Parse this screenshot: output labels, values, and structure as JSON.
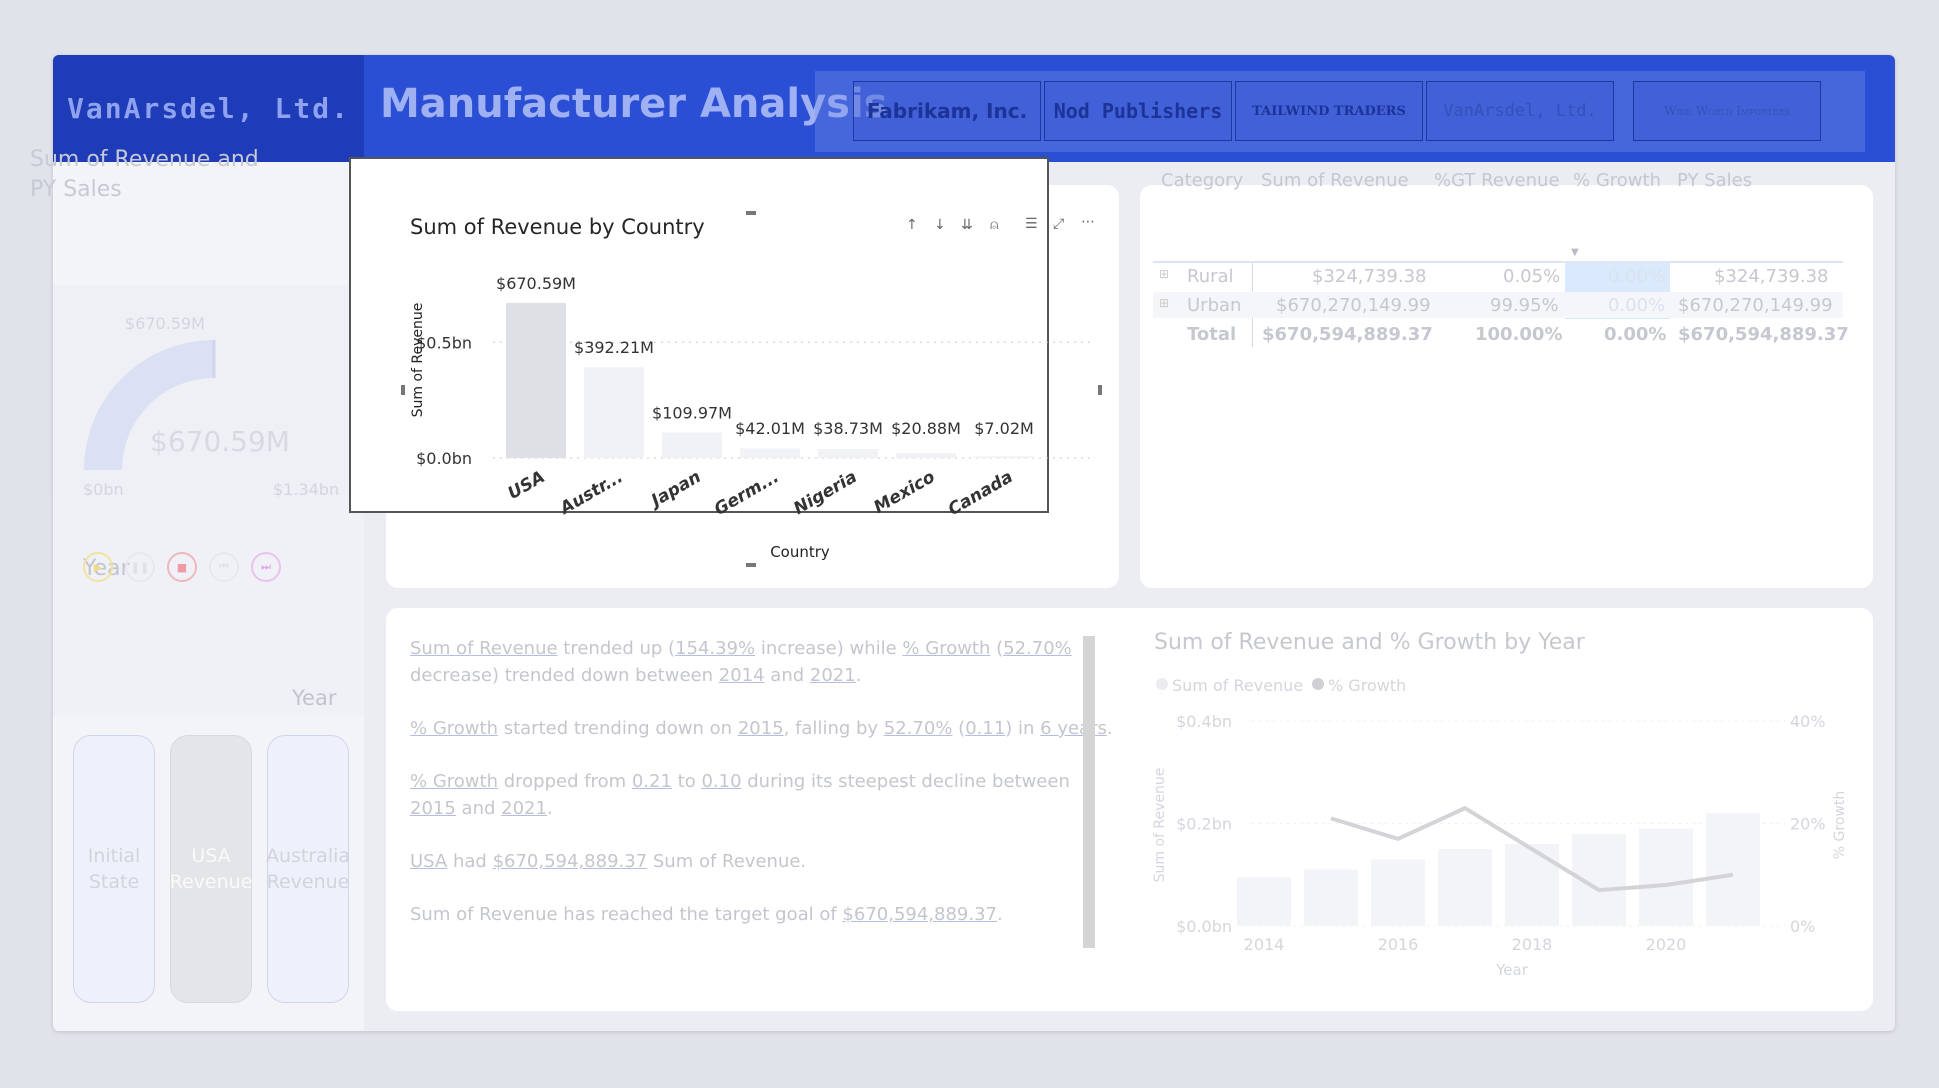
{
  "header": {
    "logo_text": "VanArsdel, Ltd.",
    "title": "Manufacturer Analysis",
    "manufacturers": [
      "Fabrikam, Inc.",
      "Nod Publishers",
      "TAILWIND TRADERS",
      "VanArsdel, Ltd.",
      "Wide World Importers"
    ]
  },
  "gauge": {
    "title": "Sum of Revenue and PY Sales",
    "target_label": "$670.59M",
    "value_label": "$670.59M",
    "min_label": "$0bn",
    "max_label": "$1.34bn",
    "fill_fraction": 0.5
  },
  "year_slicer": {
    "title": "Year",
    "play_label": "Year"
  },
  "bookmarks": [
    {
      "label": "Initial State"
    },
    {
      "label": "USA Revenue"
    },
    {
      "label": "Australia Revenue"
    }
  ],
  "bar_chart": {
    "toolbar_icons": [
      "sort-ascending-icon",
      "sort-descending-icon",
      "expand-all-icon",
      "drill-up-icon",
      "filter-icon",
      "focus-mode-icon",
      "more-options-icon"
    ]
  },
  "chart_data": [
    {
      "type": "bar",
      "title": "Sum of Revenue by Country",
      "xlabel": "Country",
      "ylabel": "Sum of Revenue",
      "categories": [
        "USA",
        "Austr...",
        "Japan",
        "Germ...",
        "Nigeria",
        "Mexico",
        "Canada"
      ],
      "values": [
        670.59,
        392.21,
        109.97,
        42.01,
        38.73,
        20.88,
        7.02
      ],
      "value_labels": [
        "$670.59M",
        "$392.21M",
        "$109.97M",
        "$42.01M",
        "$38.73M",
        "$20.88M",
        "$7.02M"
      ],
      "yticks": [
        "$0.0bn",
        "$0.5bn"
      ],
      "ytick_values": [
        0,
        500
      ],
      "ylim": [
        0,
        700
      ],
      "grid": true,
      "colors": {
        "highlight": "#dfe0e5",
        "dim": "#f1f2f6"
      }
    },
    {
      "type": "bar",
      "title": "Sum of Revenue and % Growth by Year",
      "xlabel": "Year",
      "ylabel": "Sum of Revenue",
      "y2label": "% Growth",
      "legend": [
        "Sum of Revenue",
        "% Growth"
      ],
      "legend_position": "top-left",
      "x": [
        2014,
        2015,
        2016,
        2017,
        2018,
        2019,
        2020,
        2021
      ],
      "xticks": [
        "2014",
        "2016",
        "2018",
        "2020"
      ],
      "series": [
        {
          "name": "Sum of Revenue",
          "values": [
            0.095,
            0.11,
            0.13,
            0.15,
            0.16,
            0.18,
            0.19,
            0.22
          ]
        },
        {
          "name": "% Growth",
          "values": [
            null,
            0.21,
            0.17,
            0.23,
            0.15,
            0.07,
            0.08,
            0.1
          ]
        }
      ],
      "yticks": [
        "$0.0bn",
        "$0.2bn",
        "$0.4bn"
      ],
      "y2ticks": [
        "0%",
        "20%",
        "40%"
      ],
      "ylim": [
        0,
        0.4
      ],
      "y2lim": [
        0,
        0.4
      ]
    }
  ],
  "table": {
    "columns": [
      "Category",
      "Sum of Revenue",
      "%GT Revenue",
      "% Growth",
      "PY Sales"
    ],
    "rows": [
      {
        "category": "Rural",
        "revenue": "$324,739.38",
        "gt": "0.05%",
        "growth": "0.00%",
        "py": "$324,739.38"
      },
      {
        "category": "Urban",
        "revenue": "$670,270,149.99",
        "gt": "99.95%",
        "growth": "0.00%",
        "py": "$670,270,149.99"
      }
    ],
    "total": {
      "category": "Total",
      "revenue": "$670,594,889.37",
      "gt": "100.00%",
      "growth": "0.00%",
      "py": "$670,594,889.37"
    }
  },
  "narrative": {
    "p1": [
      "Sum of Revenue",
      " trended up (",
      "154.39%",
      " increase) while ",
      "% Growth",
      " (",
      "52.70%",
      " decrease) trended down between ",
      "2014",
      " and ",
      "2021",
      "."
    ],
    "p2": [
      "% Growth",
      " started trending down on ",
      "2015",
      ", falling by ",
      "52.70%",
      " (",
      "0.11",
      ") in ",
      "6 years",
      "."
    ],
    "p3": [
      "% Growth",
      " dropped from ",
      "0.21",
      " to ",
      "0.10",
      " during its steepest decline between ",
      "2015",
      " and ",
      "2021",
      "."
    ],
    "p4": [
      "USA",
      " had ",
      "$670,594,889.37",
      " Sum of Revenue."
    ],
    "p5": [
      "Sum of Revenue has reached the target goal of ",
      "$670,594,889.37",
      "."
    ]
  }
}
